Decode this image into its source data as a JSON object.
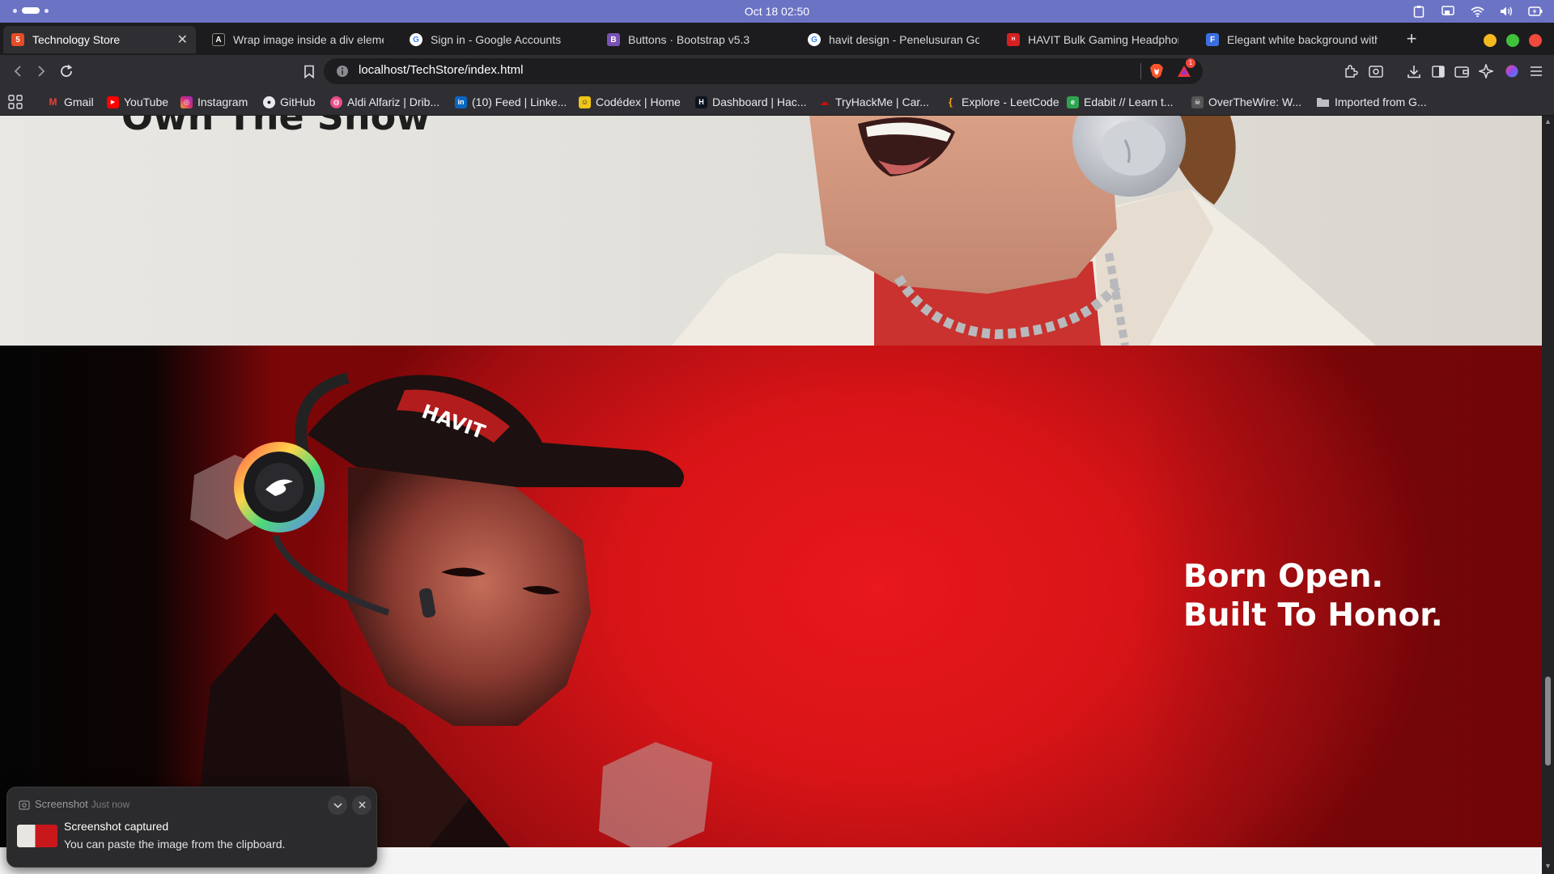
{
  "system": {
    "clock": "Oct 18  02:50"
  },
  "browser": {
    "tabs": [
      {
        "title": "Technology Store",
        "favicon": "html5-icon",
        "color": "#e44d26",
        "active": true
      },
      {
        "title": "Wrap image inside a div elemen",
        "favicon": "angular-a-icon",
        "color": "#1a1a1a",
        "active": false
      },
      {
        "title": "Sign in - Google Accounts",
        "favicon": "google-icon",
        "color": "#ffffff",
        "active": false
      },
      {
        "title": "Buttons · Bootstrap v5.3",
        "favicon": "bootstrap-icon",
        "color": "#7952b3",
        "active": false
      },
      {
        "title": "havit design - Penelusuran Goo",
        "favicon": "google-icon",
        "color": "#ffffff",
        "active": false
      },
      {
        "title": "HAVIT Bulk Gaming Headphone",
        "favicon": "havit-icon",
        "color": "#d62020",
        "active": false
      },
      {
        "title": "Elegant white background with",
        "favicon": "doc-icon",
        "color": "#3b6fe0",
        "active": false
      }
    ],
    "url": "localhost/TechStore/index.html",
    "shields_badge": "1",
    "bookmarks": [
      {
        "label": "Gmail",
        "icon": "gmail-icon",
        "color": "#ea4335"
      },
      {
        "label": "YouTube",
        "icon": "youtube-icon",
        "color": "#ff0000"
      },
      {
        "label": "Instagram",
        "icon": "instagram-icon",
        "color": "#d62976"
      },
      {
        "label": "GitHub",
        "icon": "github-icon",
        "color": "#e8eaed"
      },
      {
        "label": "Aldi Alfariz | Drib...",
        "icon": "dribbble-icon",
        "color": "#ea4c89"
      },
      {
        "label": "(10) Feed | Linke...",
        "icon": "linkedin-icon",
        "color": "#0a66c2"
      },
      {
        "label": "Codédex | Home",
        "icon": "codedex-icon",
        "color": "#f0c419"
      },
      {
        "label": "Dashboard | Hac...",
        "icon": "hackerrank-icon",
        "color": "#1ba94c"
      },
      {
        "label": "TryHackMe | Car...",
        "icon": "tryhackme-icon",
        "color": "#c11111"
      },
      {
        "label": "Explore - LeetCode",
        "icon": "leetcode-icon",
        "color": "#ffa116"
      },
      {
        "label": "Edabit // Learn t...",
        "icon": "edabit-icon",
        "color": "#2ea44f"
      },
      {
        "label": "OverTheWire: W...",
        "icon": "overthewire-icon",
        "color": "#bbbbbb"
      },
      {
        "label": "Imported from G...",
        "icon": "folder-icon",
        "color": "#c7c7c7"
      }
    ]
  },
  "page": {
    "section1_title": "Own The Show",
    "section2_line1": "Born Open.",
    "section2_line2": "Built To Honor.",
    "cap_brand": "HAVIT"
  },
  "notification": {
    "app": "Screenshot",
    "time": "Just now",
    "title": "Screenshot captured",
    "body": "You can paste the image from the clipboard."
  }
}
